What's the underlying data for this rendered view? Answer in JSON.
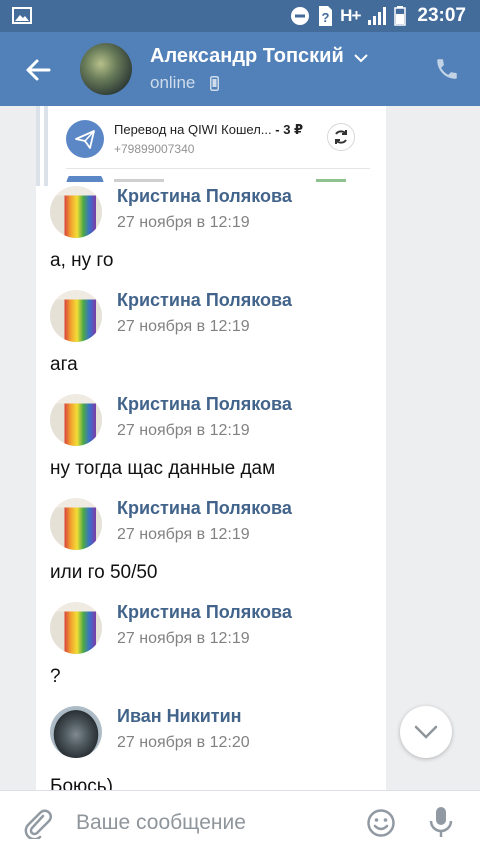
{
  "status_bar": {
    "network": "H+",
    "time": "23:07"
  },
  "header": {
    "title": "Александр Топский",
    "status": "online"
  },
  "pinned_transfer": {
    "title": "Перевод на QIWI Кошел...",
    "amount": "- 3 ₽",
    "phone": "+79899007340"
  },
  "messages": [
    {
      "author": "Кристина Полякова",
      "time": "27 ноября в 12:19",
      "text": "а, ну го"
    },
    {
      "author": "Кристина Полякова",
      "time": "27 ноября в 12:19",
      "text": "ага"
    },
    {
      "author": "Кристина Полякова",
      "time": "27 ноября в 12:19",
      "text": "ну тогда щас данные дам"
    },
    {
      "author": "Кристина Полякова",
      "time": "27 ноября в 12:19",
      "text": "или го 50/50"
    },
    {
      "author": "Кристина Полякова",
      "time": "27 ноября в 12:19",
      "text": "?"
    },
    {
      "author": "Иван Никитин",
      "time": "27 ноября в 12:20",
      "text": "Боюсь)"
    }
  ],
  "input": {
    "placeholder": "Ваше сообщение"
  },
  "colors": {
    "header": "#5181b8",
    "status_bar": "#436c9b",
    "author": "#42648b",
    "accent": "#5b87c7"
  }
}
